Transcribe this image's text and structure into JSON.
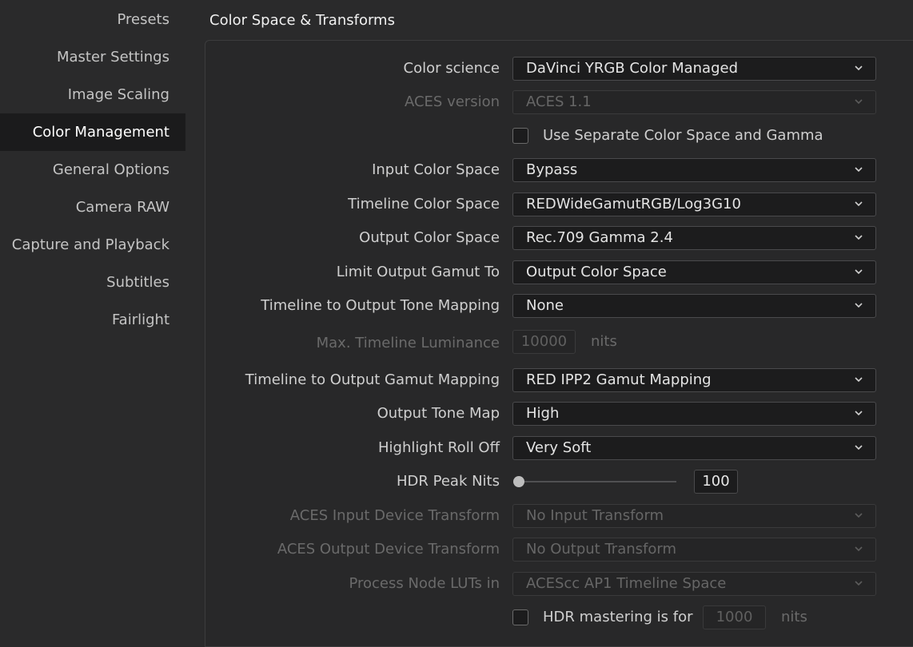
{
  "sidebar": {
    "items": [
      {
        "label": "Presets"
      },
      {
        "label": "Master Settings"
      },
      {
        "label": "Image Scaling"
      },
      {
        "label": "Color Management"
      },
      {
        "label": "General Options"
      },
      {
        "label": "Camera RAW"
      },
      {
        "label": "Capture and Playback"
      },
      {
        "label": "Subtitles"
      },
      {
        "label": "Fairlight"
      }
    ],
    "active": "Color Management"
  },
  "section": {
    "title": "Color Space & Transforms"
  },
  "fields": {
    "color_science": {
      "label": "Color science",
      "value": "DaVinci YRGB Color Managed"
    },
    "aces_version": {
      "label": "ACES version",
      "value": "ACES 1.1"
    },
    "separate_color_space": {
      "label": "Use Separate Color Space and Gamma",
      "checked": false
    },
    "input_color_space": {
      "label": "Input Color Space",
      "value": "Bypass"
    },
    "timeline_color_space": {
      "label": "Timeline Color Space",
      "value": "REDWideGamutRGB/Log3G10"
    },
    "output_color_space": {
      "label": "Output Color Space",
      "value": "Rec.709 Gamma 2.4"
    },
    "limit_output_gamut": {
      "label": "Limit Output Gamut To",
      "value": "Output Color Space"
    },
    "tone_mapping": {
      "label": "Timeline to Output Tone Mapping",
      "value": "None"
    },
    "max_luminance": {
      "label": "Max. Timeline Luminance",
      "value": "10000",
      "unit": "nits"
    },
    "gamut_mapping": {
      "label": "Timeline to Output Gamut Mapping",
      "value": "RED IPP2 Gamut Mapping"
    },
    "output_tone_map": {
      "label": "Output Tone Map",
      "value": "High"
    },
    "highlight_roll_off": {
      "label": "Highlight Roll Off",
      "value": "Very Soft"
    },
    "hdr_peak_nits": {
      "label": "HDR Peak Nits",
      "value": "100",
      "slider_fraction": 0.0
    },
    "aces_idt": {
      "label": "ACES Input Device Transform",
      "value": "No Input Transform"
    },
    "aces_odt": {
      "label": "ACES Output Device Transform",
      "value": "No Output Transform"
    },
    "process_node_luts": {
      "label": "Process Node LUTs in",
      "value": "ACEScc AP1 Timeline Space"
    },
    "hdr_mastering": {
      "label": "HDR mastering is for",
      "value": "1000",
      "unit": "nits",
      "checked": false
    }
  },
  "icons": {
    "dropdown": "chevron-down-icon"
  }
}
